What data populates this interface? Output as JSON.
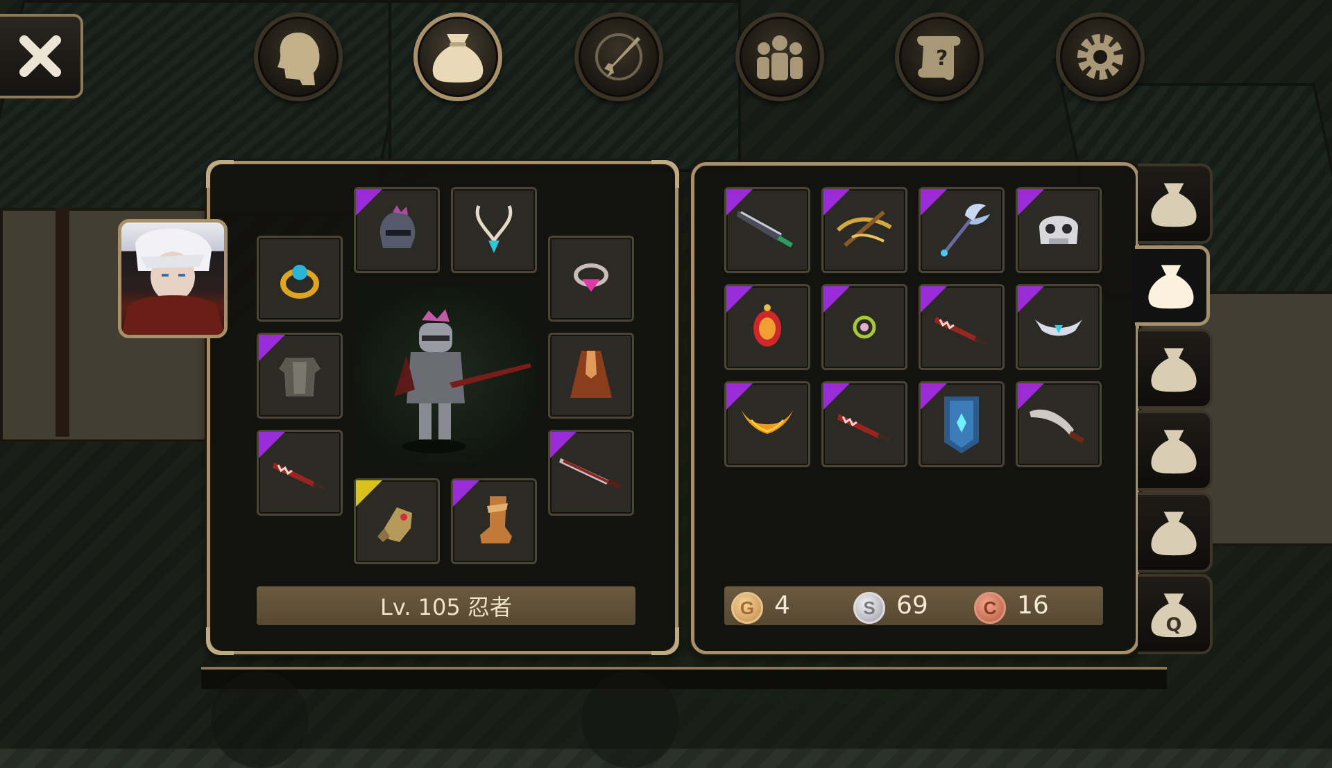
{
  "nav": {
    "close_icon": "close-x-icon",
    "tabs": [
      {
        "id": "character",
        "icon": "head-silhouette-icon",
        "active": false
      },
      {
        "id": "inventory",
        "icon": "bag-icon",
        "active": true
      },
      {
        "id": "skills",
        "icon": "sword-compass-icon",
        "active": false
      },
      {
        "id": "party",
        "icon": "group-icon",
        "active": false
      },
      {
        "id": "quests",
        "icon": "scroll-question-icon",
        "active": false
      },
      {
        "id": "settings",
        "icon": "gear-icon",
        "active": false
      }
    ]
  },
  "equipment": {
    "level_text": "Lv. 105 忍者",
    "slots": [
      {
        "slot": "helmet",
        "icon": "dark-helmet-icon",
        "rarity": "purple"
      },
      {
        "slot": "necklace",
        "icon": "pendant-necklace-icon",
        "rarity": "none"
      },
      {
        "slot": "ring-left",
        "icon": "gold-ring-icon",
        "rarity": "none"
      },
      {
        "slot": "ring-right",
        "icon": "pink-gem-ring-icon",
        "rarity": "none"
      },
      {
        "slot": "armor",
        "icon": "chain-armor-icon",
        "rarity": "purple"
      },
      {
        "slot": "cloak",
        "icon": "cloak-icon",
        "rarity": "none"
      },
      {
        "slot": "offhand",
        "icon": "jagged-blade-icon",
        "rarity": "purple"
      },
      {
        "slot": "weapon",
        "icon": "sword-icon",
        "rarity": "purple"
      },
      {
        "slot": "gloves",
        "icon": "gauntlet-icon",
        "rarity": "gold"
      },
      {
        "slot": "boots",
        "icon": "boots-icon",
        "rarity": "purple"
      }
    ]
  },
  "inventory": {
    "items": [
      {
        "icon": "dark-greatsword-icon",
        "rarity": "purple"
      },
      {
        "icon": "crossbow-icon",
        "rarity": "purple"
      },
      {
        "icon": "crystal-staff-icon",
        "rarity": "purple"
      },
      {
        "icon": "skull-mask-icon",
        "rarity": "purple"
      },
      {
        "icon": "red-amulet-icon",
        "rarity": "purple"
      },
      {
        "icon": "small-ring-icon",
        "rarity": "purple"
      },
      {
        "icon": "jagged-blade-icon",
        "rarity": "purple"
      },
      {
        "icon": "tiara-icon",
        "rarity": "purple"
      },
      {
        "icon": "flame-horns-icon",
        "rarity": "purple"
      },
      {
        "icon": "jagged-blade-icon",
        "rarity": "purple"
      },
      {
        "icon": "blue-shield-icon",
        "rarity": "purple"
      },
      {
        "icon": "curved-blade-icon",
        "rarity": "purple"
      }
    ],
    "currency": {
      "gold": {
        "symbol": "G",
        "value": "4"
      },
      "silver": {
        "symbol": "S",
        "value": "69"
      },
      "copper": {
        "symbol": "C",
        "value": "16"
      }
    },
    "bag_tabs": [
      {
        "icon": "bag-icon",
        "label": "",
        "active": false
      },
      {
        "icon": "bag-icon",
        "label": "",
        "active": true
      },
      {
        "icon": "bag-icon",
        "label": "",
        "active": false
      },
      {
        "icon": "bag-icon",
        "label": "",
        "active": false
      },
      {
        "icon": "bag-icon",
        "label": "",
        "active": false
      },
      {
        "icon": "quest-bag-icon",
        "label": "Q",
        "active": false
      }
    ]
  },
  "colors": {
    "frame": "#a68f69",
    "rarity_purple": "#9a2bd8",
    "rarity_gold": "#d9c21a",
    "text": "#efe3c8"
  }
}
